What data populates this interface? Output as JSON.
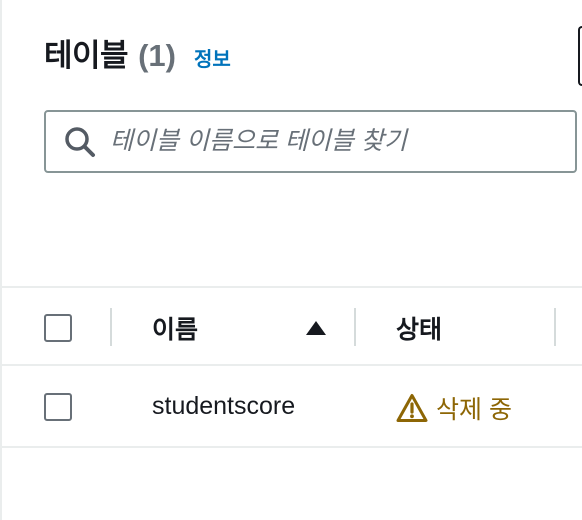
{
  "header": {
    "title": "테이블",
    "count": "(1)",
    "info_link": "정보"
  },
  "search": {
    "placeholder": "테이블 이름으로 테이블 찾기",
    "value": ""
  },
  "table": {
    "columns": [
      {
        "label": "이름",
        "sort": "ascending"
      },
      {
        "label": "상태"
      }
    ],
    "rows": [
      {
        "name": "studentscore",
        "status": "삭제 중",
        "status_icon": "warning-icon"
      }
    ]
  },
  "colors": {
    "link": "#0073bb",
    "warning": "#8d6605",
    "border": "#eaeded"
  }
}
